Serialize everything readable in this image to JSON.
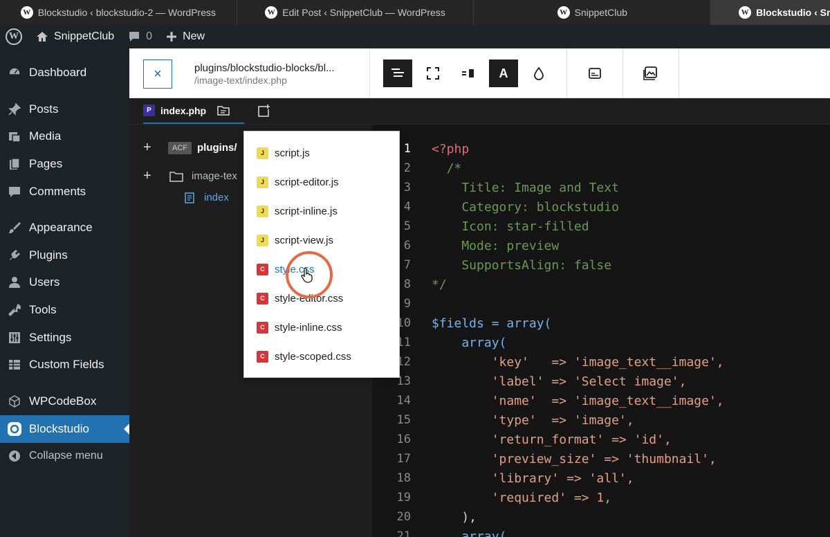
{
  "browser_tabs": [
    {
      "title": "Blockstudio ‹ blockstudio-2 — WordPress"
    },
    {
      "title": "Edit Post ‹ SnippetClub — WordPress"
    },
    {
      "title": "SnippetClub"
    },
    {
      "title": "Blockstudio ‹ Snip",
      "active": true
    }
  ],
  "admin_bar": {
    "site_name": "SnippetClub",
    "comments_count": "0",
    "new_label": "New"
  },
  "sidebar": {
    "items": [
      {
        "label": "Dashboard",
        "icon": "dashboard-icon"
      },
      {
        "label": "Posts",
        "icon": "pin-icon"
      },
      {
        "label": "Media",
        "icon": "media-icon"
      },
      {
        "label": "Pages",
        "icon": "pages-icon"
      },
      {
        "label": "Comments",
        "icon": "comment-icon"
      },
      {
        "label": "Appearance",
        "icon": "brush-icon"
      },
      {
        "label": "Plugins",
        "icon": "plug-icon"
      },
      {
        "label": "Users",
        "icon": "user-icon"
      },
      {
        "label": "Tools",
        "icon": "wrench-icon"
      },
      {
        "label": "Settings",
        "icon": "sliders-icon"
      },
      {
        "label": "Custom Fields",
        "icon": "grid-icon"
      },
      {
        "label": "WPCodeBox",
        "icon": "cube-icon"
      },
      {
        "label": "Blockstudio",
        "icon": "blockstudio-icon",
        "current": true
      }
    ],
    "collapse_label": "Collapse menu"
  },
  "toolbar": {
    "close_icon": "×",
    "path_line1": "plugins/blockstudio-blocks/bl...",
    "path_line2": "/image-text/index.php",
    "font_button": "A"
  },
  "file_tab": {
    "badge": "P",
    "label": "index.php"
  },
  "tree": {
    "root_badge": "ACF",
    "root_label": "plugins/",
    "folder_label": "image-tex",
    "file_label": "index"
  },
  "dropdown": {
    "items": [
      {
        "label": "script.js",
        "badge": "J",
        "type": "js"
      },
      {
        "label": "script-editor.js",
        "badge": "J",
        "type": "js"
      },
      {
        "label": "script-inline.js",
        "badge": "J",
        "type": "js"
      },
      {
        "label": "script-view.js",
        "badge": "J",
        "type": "js"
      },
      {
        "label": "style.css",
        "badge": "C",
        "type": "css",
        "hover": true
      },
      {
        "label": "style-editor.css",
        "badge": "C",
        "type": "css"
      },
      {
        "label": "style-inline.css",
        "badge": "C",
        "type": "css"
      },
      {
        "label": "style-scoped.css",
        "badge": "C",
        "type": "css"
      }
    ]
  },
  "code_lines": [
    {
      "n": "1",
      "text": "<?php"
    },
    {
      "n": "2",
      "text": "  /*"
    },
    {
      "n": "3",
      "text": "    Title: Image and Text"
    },
    {
      "n": "4",
      "text": "    Category: blockstudio"
    },
    {
      "n": "5",
      "text": "    Icon: star-filled"
    },
    {
      "n": "6",
      "text": "    Mode: preview"
    },
    {
      "n": "7",
      "text": "    SupportsAlign: false"
    },
    {
      "n": "8",
      "text": "*/"
    },
    {
      "n": "9",
      "text": ""
    },
    {
      "n": "10",
      "text": "$fields = array("
    },
    {
      "n": "11",
      "text": "    array("
    },
    {
      "n": "12",
      "text": "        'key'   => 'image_text__image',"
    },
    {
      "n": "13",
      "text": "        'label' => 'Select image',"
    },
    {
      "n": "14",
      "text": "        'name'  => 'image_text__image',"
    },
    {
      "n": "15",
      "text": "        'type'  => 'image',"
    },
    {
      "n": "16",
      "text": "        'return_format' => 'id',"
    },
    {
      "n": "17",
      "text": "        'preview_size' => 'thumbnail',"
    },
    {
      "n": "18",
      "text": "        'library' => 'all',"
    },
    {
      "n": "19",
      "text": "        'required' => 1,"
    },
    {
      "n": "20",
      "text": "    ),"
    },
    {
      "n": "21",
      "text": "    array("
    }
  ]
}
